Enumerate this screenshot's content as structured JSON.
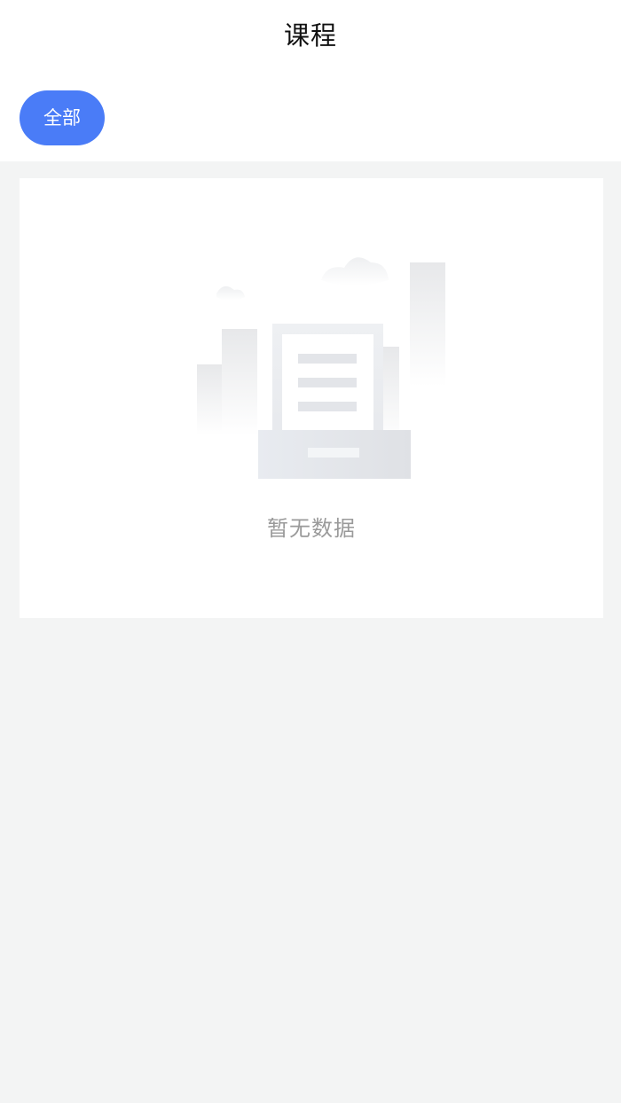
{
  "header": {
    "title": "课程"
  },
  "filters": {
    "active_label": "全部",
    "active_color": "#4a7cf7"
  },
  "empty_state": {
    "message": "暂无数据",
    "icon": "empty-document-illustration"
  },
  "colors": {
    "background": "#f3f4f4",
    "card": "#ffffff",
    "title_text": "#111111",
    "muted_text": "#9a9a9a"
  }
}
